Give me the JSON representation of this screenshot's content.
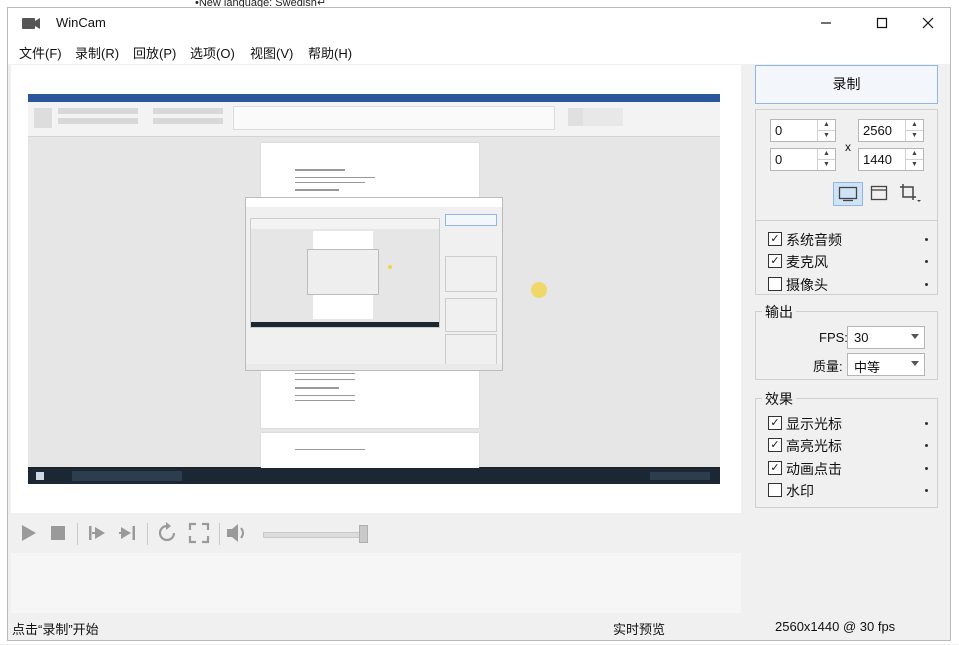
{
  "background": {
    "top_text": "•New language: Swedish↵",
    "bottom_mark": "↵"
  },
  "window": {
    "title": "WinCam",
    "buttons": {
      "minimize": "—",
      "maximize": "☐",
      "close": "✕"
    }
  },
  "menu": [
    "文件(F)",
    "录制(R)",
    "回放(P)",
    "选项(O)",
    "视图(V)",
    "帮助(H)"
  ],
  "controls": {
    "icons": [
      "play-icon",
      "stop-icon",
      "skip-start-icon",
      "skip-end-icon",
      "loop-icon",
      "fullscreen-icon",
      "volume-icon"
    ],
    "volume_level": 1.0
  },
  "status": {
    "left": "点击“录制”开始",
    "middle": "实时预览",
    "right": "2560x1440 @ 30 fps"
  },
  "panel": {
    "record_label": "录制",
    "x": "0",
    "y": "0",
    "width": "2560",
    "height": "1440",
    "x_sep": "x",
    "audio": [
      {
        "label": "系统音频",
        "checked": true
      },
      {
        "label": "麦克风",
        "checked": true
      },
      {
        "label": "摄像头",
        "checked": false
      }
    ],
    "output": {
      "title": "输出",
      "fps_label": "FPS:",
      "fps_value": "30",
      "quality_label": "质量:",
      "quality_value": "中等"
    },
    "effects": {
      "title": "效果",
      "items": [
        {
          "label": "显示光标",
          "checked": true
        },
        {
          "label": "高亮光标",
          "checked": true
        },
        {
          "label": "动画点击",
          "checked": true
        },
        {
          "label": "水印",
          "checked": false
        }
      ]
    }
  },
  "colors": {
    "accent_border": "#8fb6e6",
    "taskbar": "#1b2733",
    "ribbon": "#2b579a",
    "click_highlight": "#f3d34a"
  }
}
